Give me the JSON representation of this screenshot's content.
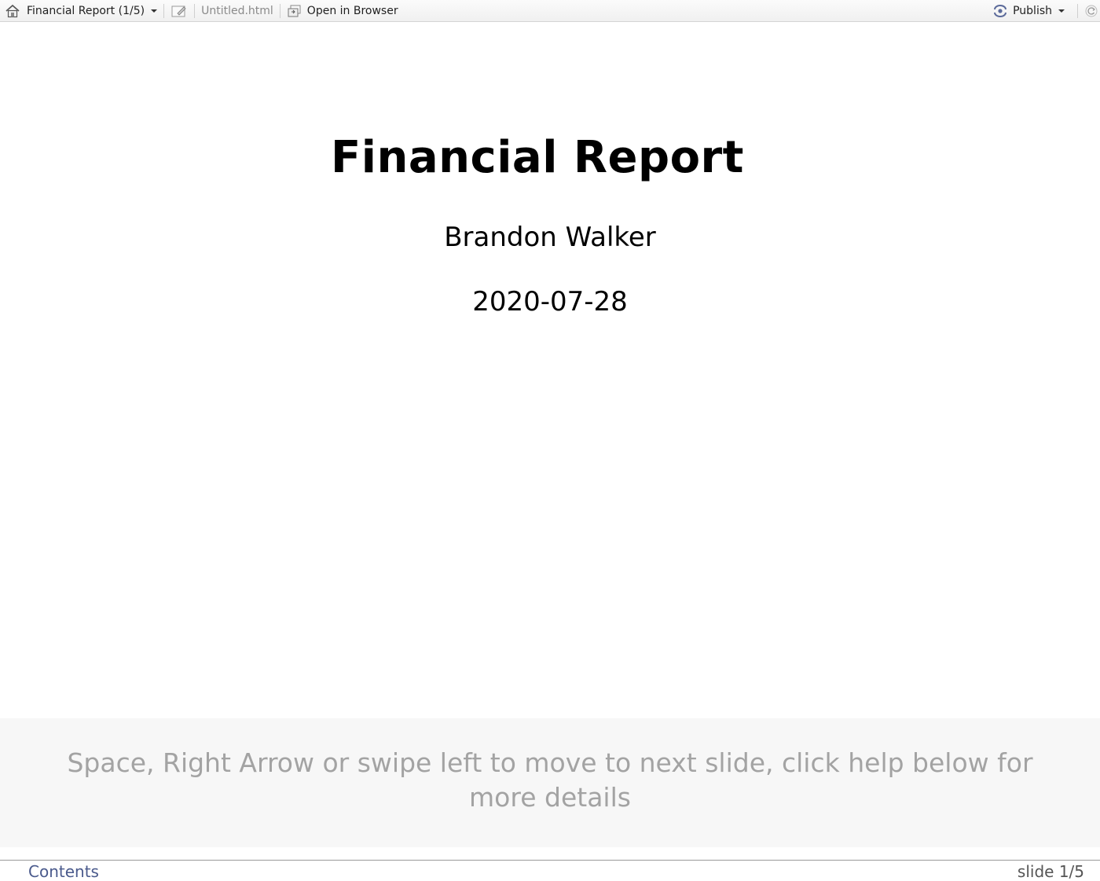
{
  "toolbar": {
    "home_icon": "home-icon",
    "presentation_title": "Financial Report (1/5)",
    "edit_icon": "pencil-icon",
    "file_name": "Untitled.html",
    "open_icon": "open-external-icon",
    "open_label": "Open in Browser",
    "publish_icon": "publish-icon",
    "publish_label": "Publish",
    "refresh_icon": "refresh-icon"
  },
  "slide": {
    "title": "Financial Report",
    "author": "Brandon Walker",
    "date": "2020-07-28"
  },
  "help": {
    "text": "Space, Right Arrow or swipe left to move to next slide, click help below for more details"
  },
  "footer": {
    "contents_label": "Contents",
    "slide_counter": "slide 1/5"
  },
  "colors": {
    "help_text": "#a3a3a3",
    "help_background": "#f7f7f7",
    "contents_link": "#4a5a8c",
    "publish_icon": "#5b6a9a"
  }
}
